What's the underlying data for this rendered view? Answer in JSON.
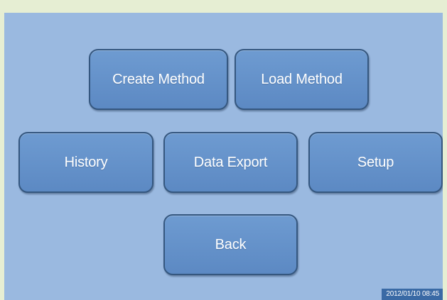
{
  "menu": {
    "create_method": "Create Method",
    "load_method": "Load Method",
    "history": "History",
    "data_export": "Data Export",
    "setup": "Setup",
    "back": "Back"
  },
  "status": {
    "datetime": "2012/01/10 08:45"
  },
  "colors": {
    "screen_background": "#9ab9e0",
    "button_fill": "#6590cb",
    "button_border": "#35577f",
    "frame": "#e6eed3",
    "timestamp_background": "#3a6aa5"
  }
}
